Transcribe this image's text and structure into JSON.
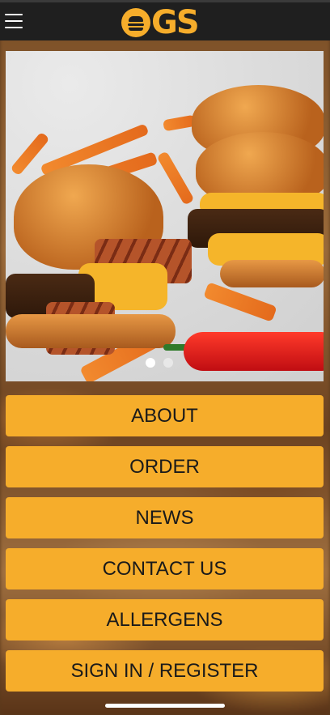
{
  "header": {
    "logo_text": "GS",
    "menu_icon": "hamburger-menu-icon",
    "brand_color": "#f6ad2b",
    "bar_color": "#1f1f1f"
  },
  "carousel": {
    "slide_count": 2,
    "active_index": 0
  },
  "menu": {
    "items": [
      {
        "label": "ABOUT"
      },
      {
        "label": "ORDER"
      },
      {
        "label": "NEWS"
      },
      {
        "label": "CONTACT US"
      },
      {
        "label": "ALLERGENS"
      },
      {
        "label": "SIGN IN / REGISTER"
      }
    ],
    "button_color": "#f6ad2b"
  }
}
